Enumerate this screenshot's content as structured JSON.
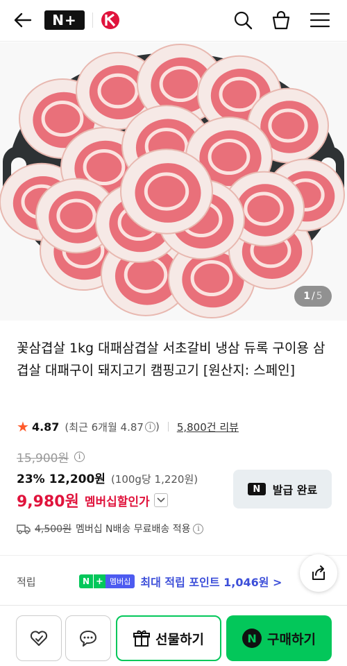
{
  "header": {
    "back_icon": "arrow-left-icon",
    "logo_text": "N+",
    "icons": [
      "search-icon",
      "shopping-bag-icon",
      "menu-icon"
    ]
  },
  "gallery": {
    "current": "1",
    "separator": "/",
    "total": "5"
  },
  "product": {
    "title": "꽃삼겹살 1kg 대패삼겹살 서초갈비 냉삼 듀록 구이용 삼겹살 대패구이 돼지고기 캠핑고기 [원산지: 스페인]",
    "rating": "4.87",
    "recent_rating": "(최근 6개월 4.87",
    "recent_rating_close": ")",
    "reviews": "5,800건 리뷰",
    "original_price": "15,900원",
    "discount_pct": "23%",
    "sale_price": "12,200원",
    "unit_price": "(100g당 1,220원)",
    "member_price": "9,980원",
    "member_label": "멤버십할인가",
    "issued_button": "발급 완료",
    "issued_badge": "N",
    "shipping_fee": "4,500원",
    "shipping_text": "멤버십 N배송 무료배송 적용",
    "points_label": "적립",
    "points_badge_n": "N",
    "points_badge_plus": "+",
    "points_badge_member": "멤버십",
    "points_value": "최대 적립 포인트 1,046원 >"
  },
  "bottom_bar": {
    "gift_label": "선물하기",
    "buy_label": "구매하기",
    "buy_badge": "N"
  },
  "colors": {
    "brand_green": "#03c75a",
    "member_red": "#e0133c",
    "points_blue": "#3d4fd9",
    "rating_star": "#ff5a2a"
  }
}
